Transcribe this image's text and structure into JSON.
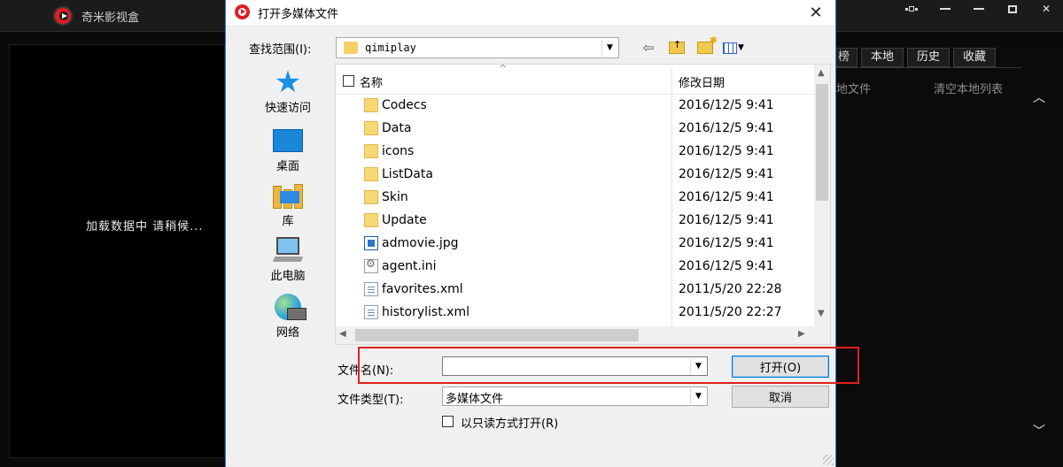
{
  "app": {
    "title": "奇米影视盒",
    "loading": "加载数据中 请稍候...",
    "tabs": [
      "榜",
      "本地",
      "历史",
      "收藏"
    ],
    "local_file": "地文件",
    "clear_list": "清空本地列表"
  },
  "dialog": {
    "title": "打开多媒体文件",
    "look_in_label": "查找范围(I):",
    "look_in_value": "qimiplay",
    "places": [
      "快速访问",
      "桌面",
      "库",
      "此电脑",
      "网络"
    ],
    "columns": {
      "name": "名称",
      "date": "修改日期"
    },
    "files": [
      {
        "name": "Codecs",
        "date": "2016/12/5 9:41",
        "type": "folder"
      },
      {
        "name": "Data",
        "date": "2016/12/5 9:41",
        "type": "folder"
      },
      {
        "name": "icons",
        "date": "2016/12/5 9:41",
        "type": "folder"
      },
      {
        "name": "ListData",
        "date": "2016/12/5 9:41",
        "type": "folder"
      },
      {
        "name": "Skin",
        "date": "2016/12/5 9:41",
        "type": "folder"
      },
      {
        "name": "Update",
        "date": "2016/12/5 9:41",
        "type": "folder"
      },
      {
        "name": "admovie.jpg",
        "date": "2016/12/5 9:41",
        "type": "img"
      },
      {
        "name": "agent.ini",
        "date": "2016/12/5 9:41",
        "type": "ini"
      },
      {
        "name": "favorites.xml",
        "date": "2011/5/20 22:28",
        "type": "file"
      },
      {
        "name": "historylist.xml",
        "date": "2011/5/20 22:27",
        "type": "file"
      }
    ],
    "file_name_label": "文件名(N):",
    "file_name_value": "",
    "file_type_label": "文件类型(T):",
    "file_type_value": "多媒体文件",
    "open_button": "打开(O)",
    "cancel_button": "取消",
    "readonly_label": "以只读方式打开(R)",
    "close_glyph": "✕"
  },
  "colors": {
    "highlight": "#e02020",
    "accent": "#0078d7"
  }
}
